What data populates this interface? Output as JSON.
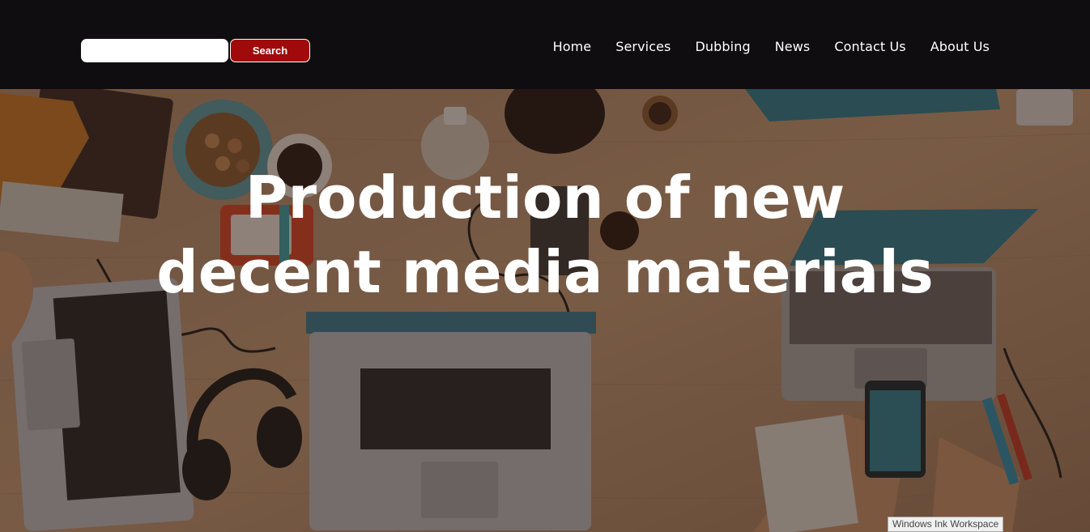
{
  "header": {
    "search": {
      "value": "",
      "placeholder": "",
      "button_label": "Search"
    },
    "nav": [
      {
        "label": "Home"
      },
      {
        "label": "Services"
      },
      {
        "label": "Dubbing"
      },
      {
        "label": "News"
      },
      {
        "label": "Contact Us"
      },
      {
        "label": "About Us"
      }
    ]
  },
  "hero": {
    "title": "Production of new decent media materials",
    "background": "top-down photo of a wooden desk with laptops, headphones, phone, coffee cups and snacks"
  },
  "system": {
    "tooltip": "Windows Ink Workspace"
  },
  "colors": {
    "header_bg": "#0f0d10",
    "search_button_bg": "#a00a0a",
    "hero_text": "#ffffff"
  }
}
